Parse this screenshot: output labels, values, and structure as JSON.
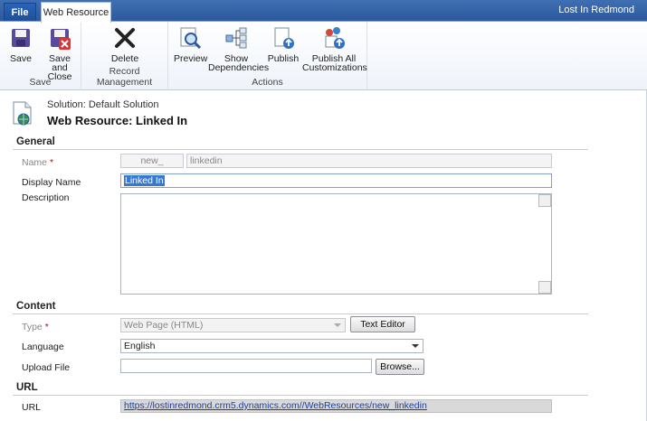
{
  "tabs": {
    "file": "File",
    "web_resource": "Web Resource"
  },
  "user": "Lost In Redmond",
  "ribbon": {
    "groups": [
      {
        "label": "Save"
      },
      {
        "label": "Record Management"
      },
      {
        "label": "Actions"
      }
    ],
    "buttons": {
      "save": "Save",
      "save_close_1": "Save and",
      "save_close_2": "Close",
      "delete": "Delete",
      "preview": "Preview",
      "show_dep_1": "Show",
      "show_dep_2": "Dependencies",
      "publish": "Publish",
      "publish_all_1": "Publish All",
      "publish_all_2": "Customizations"
    }
  },
  "header": {
    "solution": "Solution: Default Solution",
    "title": "Web Resource: Linked In"
  },
  "general": {
    "title": "General",
    "name_label": "Name",
    "required_mark": "*",
    "name_prefix": "new_",
    "name_value": "linkedin",
    "display_name_label": "Display Name",
    "display_name_value": "Linked In",
    "description_label": "Description"
  },
  "content": {
    "title": "Content",
    "type_label": "Type",
    "type_value": "Web Page (HTML)",
    "text_editor_button": "Text Editor",
    "language_label": "Language",
    "language_value": "English",
    "upload_label": "Upload File",
    "browse_button": "Browse..."
  },
  "url_section": {
    "title": "URL",
    "url_label": "URL",
    "url_value": "https://lostinredmond.crm5.dynamics.com//WebResources/new_linkedin"
  },
  "colors": {
    "topbar": "#2c5a9c",
    "selection": "#3779d0",
    "link": "#1a3fa6"
  }
}
